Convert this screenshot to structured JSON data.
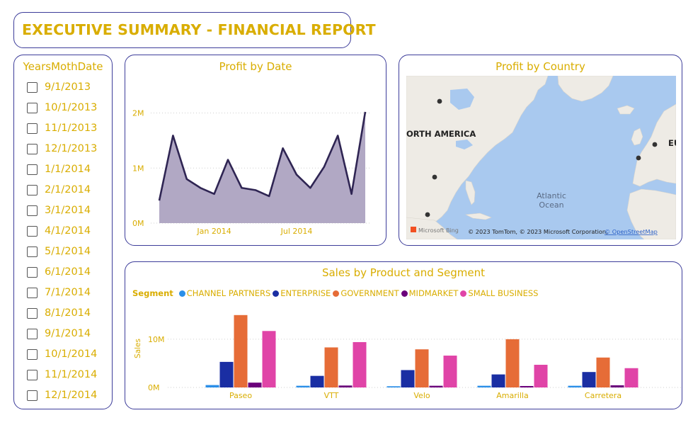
{
  "title": "EXECUTIVE SUMMARY - FINANCIAL REPORT",
  "slicer": {
    "header": "YearsMothDate",
    "items": [
      "9/1/2013",
      "10/1/2013",
      "11/1/2013",
      "12/1/2013",
      "1/1/2014",
      "2/1/2014",
      "3/1/2014",
      "4/1/2014",
      "5/1/2014",
      "6/1/2014",
      "7/1/2014",
      "8/1/2014",
      "9/1/2014",
      "10/1/2014",
      "11/1/2014",
      "12/1/2014"
    ]
  },
  "profit_by_date": {
    "title": "Profit by Date"
  },
  "profit_by_country": {
    "title": "Profit by Country",
    "labels": {
      "north_america": "ORTH AMERICA",
      "europe": "EU",
      "atlantic": "Atlantic",
      "ocean": "Ocean"
    },
    "bing": "Microsoft Bing",
    "attribution": "© 2023 TomTom, © 2023 Microsoft Corporation,",
    "osm": "© OpenStreetMap"
  },
  "sales_by_product": {
    "title": "Sales by Product and Segment",
    "legend_title": "Segment"
  },
  "colors": {
    "accent": "#d9ad00",
    "border": "#3d3d9a",
    "area_fill": "#b1a8c4",
    "area_line": "#2f2553",
    "channel_partners": "#2b8fe8",
    "enterprise": "#1a2ea3",
    "government": "#e66c37",
    "midmarket": "#6b007b",
    "small_business": "#e044a7"
  },
  "chart_data": [
    {
      "type": "area",
      "title": "Profit by Date",
      "x": [
        "2013-09-01",
        "2013-10-01",
        "2013-11-01",
        "2013-12-01",
        "2014-01-01",
        "2014-02-01",
        "2014-03-01",
        "2014-04-01",
        "2014-05-01",
        "2014-06-01",
        "2014-07-01",
        "2014-08-01",
        "2014-09-01",
        "2014-10-01",
        "2014-11-01",
        "2014-12-01"
      ],
      "values": [
        410000,
        1590000,
        800000,
        640000,
        530000,
        1150000,
        640000,
        600000,
        490000,
        1360000,
        880000,
        640000,
        1020000,
        1590000,
        530000,
        2020000
      ],
      "x_tick_labels": [
        "Jan 2014",
        "Jul 2014"
      ],
      "y_ticks": [
        0,
        1000000,
        2000000
      ],
      "y_tick_labels": [
        "0M",
        "1M",
        "2M"
      ],
      "ylim": [
        0,
        2200000
      ],
      "grid": true
    },
    {
      "type": "bar",
      "title": "Sales by Product and Segment",
      "legend_title": "Segment",
      "legend_position": "top-left",
      "categories": [
        "Paseo",
        "VTT",
        "Velo",
        "Amarilla",
        "Carretera"
      ],
      "series": [
        {
          "name": "CHANNEL PARTNERS",
          "values": [
            500000,
            350000,
            250000,
            350000,
            350000
          ]
        },
        {
          "name": "ENTERPRISE",
          "values": [
            5300000,
            2400000,
            3600000,
            2700000,
            3200000
          ]
        },
        {
          "name": "GOVERNMENT",
          "values": [
            15000000,
            8300000,
            7900000,
            10000000,
            6200000
          ]
        },
        {
          "name": "MIDMARKET",
          "values": [
            1000000,
            400000,
            350000,
            300000,
            450000
          ]
        },
        {
          "name": "SMALL BUSINESS",
          "values": [
            11700000,
            9400000,
            6600000,
            4700000,
            4000000
          ]
        }
      ],
      "ylabel": "Sales",
      "y_ticks": [
        0,
        10000000
      ],
      "y_tick_labels": [
        "0M",
        "10M"
      ],
      "ylim": [
        0,
        16000000
      ],
      "grid": true
    }
  ]
}
